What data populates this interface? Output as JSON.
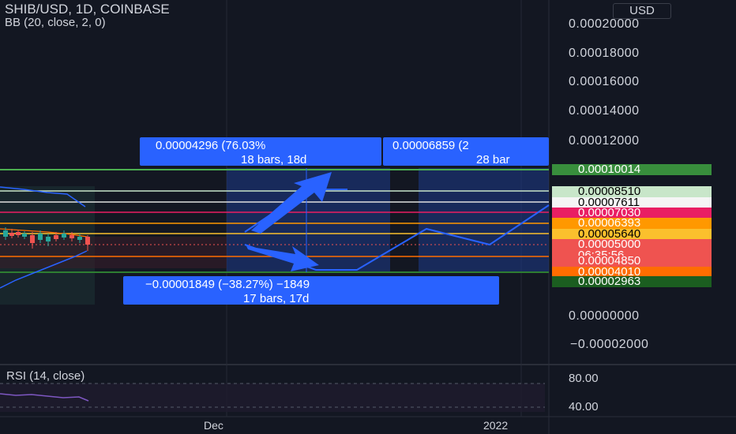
{
  "header": {
    "symbol_line": "SHIB/USD, 1D, COINBASE",
    "indicator_line": "BB (20, close, 2, 0)",
    "currency": "USD"
  },
  "price_scale": {
    "ticks": [
      "0.00020000",
      "0.00018000",
      "0.00016000",
      "0.00014000",
      "0.00012000",
      "0.00000000",
      "−0.00002000"
    ],
    "tags": [
      {
        "label": "0.00010014",
        "bg": "#388e3c",
        "fg": "#ffffff"
      },
      {
        "label": "0.00008510",
        "bg": "#c8e6c9",
        "fg": "#000000"
      },
      {
        "label": "0.00007611",
        "bg": "#f5f5f5",
        "fg": "#000000"
      },
      {
        "label": "0.00007030",
        "bg": "#e91e63",
        "fg": "#ffffff"
      },
      {
        "label": "0.00006393",
        "bg": "#ff9800",
        "fg": "#ffffff"
      },
      {
        "label": "0.00005640",
        "bg": "#fbc02d",
        "fg": "#000000"
      },
      {
        "label": "0.00005000",
        "bg": "#ef5350",
        "fg": "#ffffff"
      },
      {
        "label": "06:35:56",
        "bg": "#ef5350",
        "fg": "#ffffff"
      },
      {
        "label": "0.00004850",
        "bg": "#ef5350",
        "fg": "#ffffff"
      },
      {
        "label": "0.00004010",
        "bg": "#ff6d00",
        "fg": "#ffffff"
      },
      {
        "label": "0.00002963",
        "bg": "#1b5e20",
        "fg": "#ffffff"
      }
    ]
  },
  "measures": {
    "up1": {
      "line1": "0.00004296 (76.03%",
      "line2": "18 bars, 18d"
    },
    "up2": {
      "line1": "0.00006859 (2",
      "line2": "28 bar"
    },
    "down": {
      "line1": "−0.00001849 (−38.27%) −1849",
      "line2": "17 bars, 17d"
    }
  },
  "rsi": {
    "label": "RSI (14, close)",
    "ticks": [
      "80.00",
      "40.00"
    ]
  },
  "time_axis": {
    "labels": [
      "Dec",
      "2022"
    ]
  },
  "colors": {
    "background": "#131722",
    "measure_blue": "#2962ff",
    "candle_up": "#26a69a",
    "candle_down": "#ef5350"
  }
}
